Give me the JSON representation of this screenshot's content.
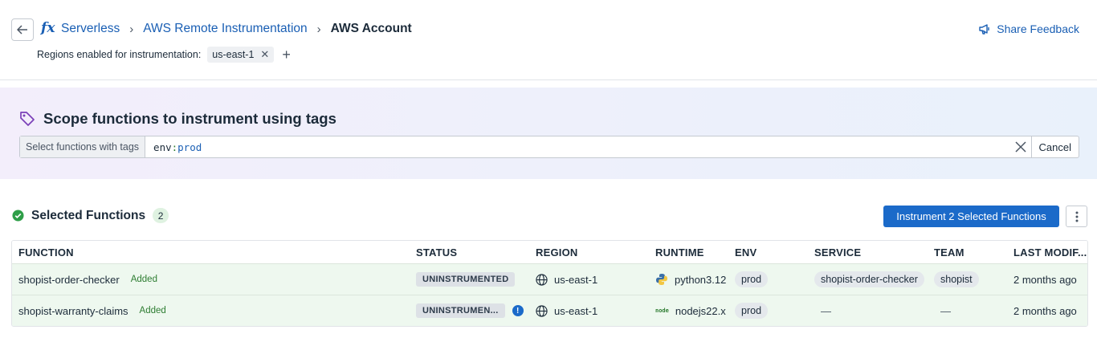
{
  "breadcrumb": {
    "items": [
      "Serverless",
      "AWS Remote Instrumentation"
    ],
    "current": "AWS Account",
    "separator": "›"
  },
  "header": {
    "fx_icon": "fx",
    "feedback_label": "Share Feedback",
    "regions_label": "Regions enabled for instrumentation:",
    "regions": [
      "us-east-1"
    ]
  },
  "scope": {
    "title": "Scope functions to instrument using tags",
    "search_label": "Select functions with tags",
    "query_key": "env",
    "query_colon": ":",
    "query_value": "prod",
    "cancel_label": "Cancel"
  },
  "selected": {
    "title": "Selected Functions",
    "count": "2",
    "instrument_label": "Instrument 2 Selected Functions"
  },
  "table": {
    "columns": [
      "FUNCTION",
      "STATUS",
      "REGION",
      "RUNTIME",
      "ENV",
      "SERVICE",
      "TEAM",
      "LAST MODIF..."
    ],
    "rows": [
      {
        "function": "shopist-order-checker",
        "added": "Added",
        "status": "UNINSTRUMENTED",
        "region": "us-east-1",
        "runtime": "python3.12",
        "runtime_icon": "python-icon",
        "env": "prod",
        "service": "shopist-order-checker",
        "team": "shopist",
        "last_modified": "2 months ago"
      },
      {
        "function": "shopist-warranty-claims",
        "added": "Added",
        "status": "UNINSTRUMEN...",
        "status_info": "!",
        "region": "us-east-1",
        "runtime": "nodejs22.x",
        "runtime_icon": "nodejs-icon",
        "node_logo_text": "node",
        "env": "prod",
        "service": "—",
        "team": "—",
        "last_modified": "2 months ago"
      }
    ]
  },
  "colors": {
    "link": "#1a5fb4",
    "primary_button": "#1b6ac9",
    "success": "#2e9e48",
    "tag_icon": "#7a3fb8",
    "row_selected_bg": "#eef8ef"
  }
}
